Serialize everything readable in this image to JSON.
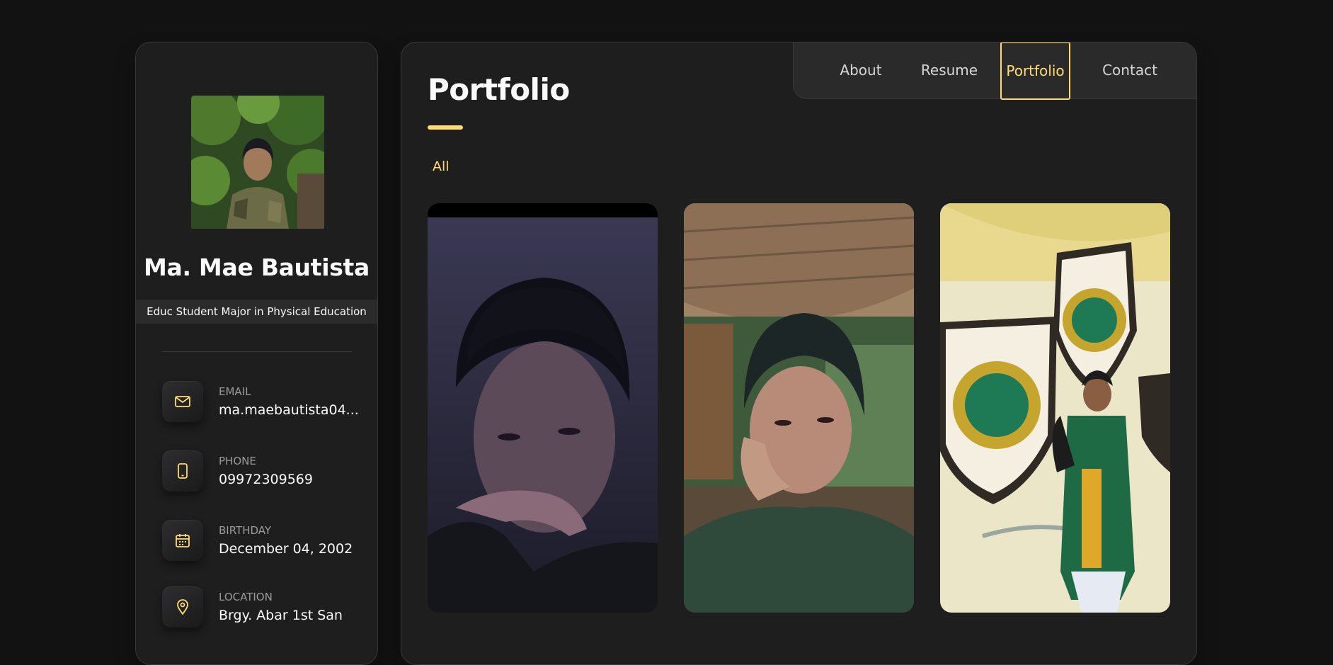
{
  "sidebar": {
    "name": "Ma. Mae Bautista",
    "title": "Educ Student Major in Physical Education",
    "contacts": [
      {
        "label": "EMAIL",
        "value": "ma.maebautista04...",
        "icon": "mail-icon"
      },
      {
        "label": "PHONE",
        "value": "09972309569",
        "icon": "phone-icon"
      },
      {
        "label": "BIRTHDAY",
        "value": "December 04, 2002",
        "icon": "calendar-icon"
      },
      {
        "label": "LOCATION",
        "value": "Brgy. Abar 1st San",
        "icon": "location-icon"
      }
    ]
  },
  "navbar": {
    "items": [
      "About",
      "Resume",
      "Portfolio",
      "Contact"
    ],
    "active": "Portfolio"
  },
  "main": {
    "title": "Portfolio",
    "filter": "All"
  },
  "colors": {
    "accent": "#ffdb70",
    "background": "#121212",
    "panel": "#1e1e1f",
    "border": "#383838"
  }
}
